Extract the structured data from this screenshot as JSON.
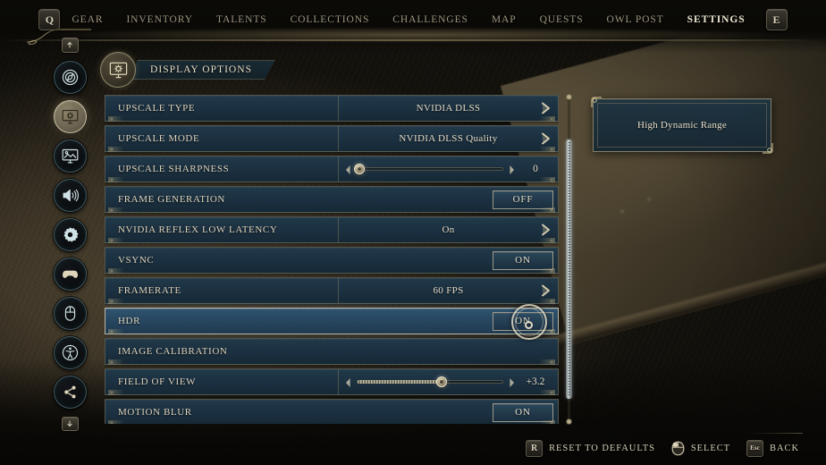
{
  "nav": {
    "left_key": "Q",
    "right_key": "E",
    "items": [
      {
        "label": "GEAR",
        "active": false
      },
      {
        "label": "INVENTORY",
        "active": false
      },
      {
        "label": "TALENTS",
        "active": false
      },
      {
        "label": "COLLECTIONS",
        "active": false
      },
      {
        "label": "CHALLENGES",
        "active": false
      },
      {
        "label": "MAP",
        "active": false
      },
      {
        "label": "QUESTS",
        "active": false
      },
      {
        "label": "OWL POST",
        "active": false
      },
      {
        "label": "SETTINGS",
        "active": true
      }
    ]
  },
  "sidebar": {
    "scroll_up": "▲",
    "scroll_down": "▼",
    "items": [
      {
        "name": "gameplay",
        "icon": "compass-icon",
        "selected": false
      },
      {
        "name": "display",
        "icon": "display-icon",
        "selected": true
      },
      {
        "name": "graphics",
        "icon": "image-icon",
        "selected": false
      },
      {
        "name": "audio",
        "icon": "speaker-icon",
        "selected": false
      },
      {
        "name": "general",
        "icon": "gear-icon",
        "selected": false
      },
      {
        "name": "controller",
        "icon": "gamepad-icon",
        "selected": false
      },
      {
        "name": "mouse-keyboard",
        "icon": "mouse-icon",
        "selected": false
      },
      {
        "name": "accessibility",
        "icon": "accessibility-icon",
        "selected": false
      },
      {
        "name": "network",
        "icon": "share-icon",
        "selected": false
      }
    ]
  },
  "panel": {
    "title": "DISPLAY OPTIONS",
    "icon": "display-settings-icon"
  },
  "settings": {
    "rows": [
      {
        "label": "UPSCALE TYPE",
        "type": "select",
        "value": "NVIDIA DLSS",
        "selected": false
      },
      {
        "label": "UPSCALE MODE",
        "type": "select",
        "value": "NVIDIA DLSS Quality",
        "selected": false
      },
      {
        "label": "UPSCALE SHARPNESS",
        "type": "slider",
        "value": "0",
        "percent": 2,
        "selected": false
      },
      {
        "label": "FRAME GENERATION",
        "type": "toggle",
        "value": "OFF",
        "selected": false
      },
      {
        "label": "NVIDIA REFLEX LOW LATENCY",
        "type": "select",
        "value": "On",
        "selected": false
      },
      {
        "label": "VSYNC",
        "type": "toggle",
        "value": "ON",
        "selected": false
      },
      {
        "label": "FRAMERATE",
        "type": "select",
        "value": "60 FPS",
        "selected": false
      },
      {
        "label": "HDR",
        "type": "toggle",
        "value": "ON",
        "selected": true
      },
      {
        "label": "IMAGE CALIBRATION",
        "type": "action",
        "value": "",
        "selected": false
      },
      {
        "label": "FIELD OF VIEW",
        "type": "slider",
        "value": "+3.2",
        "percent": 58,
        "selected": false
      },
      {
        "label": "MOTION BLUR",
        "type": "toggle",
        "value": "ON",
        "selected": false
      }
    ]
  },
  "tooltip": {
    "text": "High Dynamic Range"
  },
  "footer": {
    "reset_key": "R",
    "reset_label": "RESET TO DEFAULTS",
    "select_icon": "mouse-icon",
    "select_label": "SELECT",
    "back_key": "Esc",
    "back_label": "BACK"
  },
  "colors": {
    "row_bg": "#1b3040",
    "row_selected": "#27465f",
    "accent_gold": "#a89c76",
    "text_light": "#e4ddc9"
  }
}
